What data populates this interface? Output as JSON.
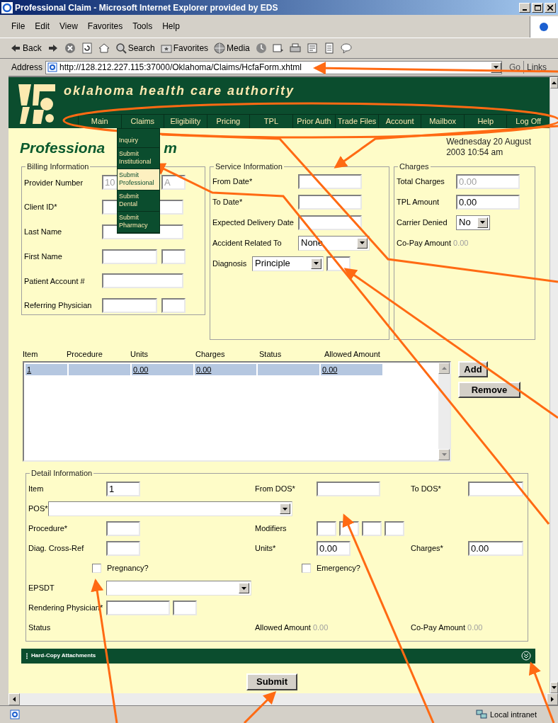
{
  "window": {
    "title": "Professional Claim - Microsoft Internet Explorer provided by EDS"
  },
  "menu_bar": [
    "File",
    "Edit",
    "View",
    "Favorites",
    "Tools",
    "Help"
  ],
  "toolbar": [
    {
      "kind": "back",
      "label": "Back"
    },
    {
      "kind": "forward"
    },
    {
      "kind": "stop"
    },
    {
      "kind": "refresh"
    },
    {
      "kind": "home"
    },
    {
      "kind": "search",
      "label": "Search"
    },
    {
      "kind": "favorites",
      "label": "Favorites"
    },
    {
      "kind": "media",
      "label": "Media"
    },
    {
      "kind": "history"
    },
    {
      "kind": "mail"
    },
    {
      "kind": "print"
    },
    {
      "kind": "edit"
    },
    {
      "kind": "discuss"
    },
    {
      "kind": "messenger"
    }
  ],
  "address_bar": {
    "label": "Address",
    "value": "http://128.212.227.115:37000/Oklahoma/Claims/HcfaForm.xhtml",
    "go": "Go",
    "links": "Links"
  },
  "header": {
    "title": "oklahoma health care authority"
  },
  "nav": [
    "Main",
    "Claims",
    "Eligibility",
    "Pricing",
    "TPL",
    "Prior Auth",
    "Trade Files",
    "Account",
    "Mailbox",
    "Help",
    "Log Off"
  ],
  "claims_menu": [
    {
      "label": "Inquiry",
      "selected": false
    },
    {
      "label": "Submit Institutional",
      "selected": false
    },
    {
      "label": "Submit Professional",
      "selected": true
    },
    {
      "label": "Submit Dental",
      "selected": false
    },
    {
      "label": "Submit Pharmacy",
      "selected": false
    }
  ],
  "page_title": [
    "Professiona",
    "m"
  ],
  "date_lines": [
    "Wednesday 20 August",
    "2003 10:54 am"
  ],
  "billing": {
    "legend": "Billing Information",
    "fields": [
      {
        "label": "Provider Number",
        "inputs": [
          {
            "kind": "wide",
            "value": "10",
            "disabled": true
          },
          {
            "kind": "small",
            "value": "A",
            "disabled": true
          }
        ]
      },
      {
        "label": "Client ID*",
        "inputs": [
          {
            "kind": "wider"
          }
        ]
      },
      {
        "label": "Last Name",
        "inputs": [
          {
            "kind": "wider"
          }
        ]
      },
      {
        "label": "First Name",
        "inputs": [
          {
            "kind": "wide"
          },
          {
            "kind": "small"
          }
        ]
      },
      {
        "label": "Patient Account #",
        "inputs": [
          {
            "kind": "wider"
          }
        ]
      },
      {
        "label": "Referring Physician",
        "inputs": [
          {
            "kind": "wide"
          },
          {
            "kind": "small"
          }
        ]
      }
    ]
  },
  "service": {
    "legend": "Service Information",
    "fields": [
      {
        "label": "From Date*",
        "inputs": [
          {
            "kind": "text"
          }
        ]
      },
      {
        "label": "To Date*",
        "inputs": [
          {
            "kind": "text"
          }
        ]
      },
      {
        "label": "Expected Delivery Date",
        "inputs": [
          {
            "kind": "text"
          }
        ]
      },
      {
        "label": "Accident Related To",
        "inputs": [
          {
            "kind": "select",
            "value": "None"
          }
        ]
      },
      {
        "label": "Diagnosis",
        "inputs": [
          {
            "kind": "select",
            "value": "Principle"
          },
          {
            "kind": "small"
          }
        ]
      }
    ]
  },
  "charges": {
    "legend": "Charges",
    "fields": [
      {
        "label": "Total Charges",
        "kind": "input",
        "value": "0.00",
        "disabled": true
      },
      {
        "label": "TPL Amount",
        "kind": "input",
        "value": "0.00",
        "disabled": false
      },
      {
        "label": "Carrier Denied",
        "kind": "select",
        "value": "No"
      },
      {
        "label": "Co-Pay Amount",
        "kind": "readout",
        "value": "0.00"
      }
    ]
  },
  "line_items": {
    "columns": [
      "Item",
      "Procedure",
      "Units",
      "Charges",
      "Status",
      "Allowed Amount"
    ],
    "rows": [
      {
        "selected": true,
        "cells": [
          "1",
          "",
          "0.00",
          "0.00",
          "",
          "0.00"
        ]
      }
    ]
  },
  "line_buttons": [
    "Add",
    "Remove"
  ],
  "detail": {
    "legend": "Detail Information",
    "rows": [
      [
        {
          "kind": "field",
          "label": "Item",
          "inputs": [
            {
              "kind": "short",
              "value": "1"
            }
          ]
        },
        {
          "kind": "field",
          "label": "From DOS*",
          "inputs": [
            {
              "kind": "text"
            }
          ]
        },
        {
          "kind": "field",
          "label": "To DOS*",
          "inputs": [
            {
              "kind": "wide"
            }
          ]
        }
      ],
      [
        {
          "kind": "field",
          "label": "POS*",
          "inputs": [
            {
              "kind": "select-long"
            }
          ]
        }
      ],
      [
        {
          "kind": "field",
          "label": "Procedure*",
          "inputs": [
            {
              "kind": "short"
            }
          ]
        },
        {
          "kind": "field",
          "label": "Modifiers",
          "inputs": [
            {
              "kind": "tiny"
            },
            {
              "kind": "tiny"
            },
            {
              "kind": "tiny"
            },
            {
              "kind": "tiny"
            }
          ]
        }
      ],
      [
        {
          "kind": "field",
          "label": "Diag. Cross-Ref",
          "inputs": [
            {
              "kind": "short"
            }
          ]
        },
        {
          "kind": "field",
          "label": "Units*",
          "inputs": [
            {
              "kind": "short",
              "value": "0.00"
            }
          ]
        },
        {
          "kind": "field",
          "label": "Charges*",
          "inputs": [
            {
              "kind": "wide",
              "value": "0.00"
            }
          ]
        }
      ],
      [
        {
          "kind": "checkbox",
          "label": "Pregnancy?",
          "checked": false
        },
        {
          "kind": "checkbox",
          "label": "Emergency?",
          "checked": false
        }
      ],
      [
        {
          "kind": "field",
          "label": "EPSDT",
          "inputs": [
            {
              "kind": "select-mid"
            }
          ]
        }
      ],
      [
        {
          "kind": "field",
          "label": "Rendering Physician*",
          "inputs": [
            {
              "kind": "text"
            },
            {
              "kind": "small"
            }
          ]
        }
      ],
      [
        {
          "kind": "readout",
          "label": "Status"
        },
        {
          "kind": "readout",
          "label": "Allowed Amount",
          "value": "0.00"
        },
        {
          "kind": "readout",
          "label": "Co-Pay Amount",
          "value": "0.00"
        }
      ]
    ]
  },
  "attachments_bar": {
    "title": "Hard-Copy Attachments"
  },
  "submit": "Submit",
  "status_bar": {
    "zone": "Local intranet"
  }
}
